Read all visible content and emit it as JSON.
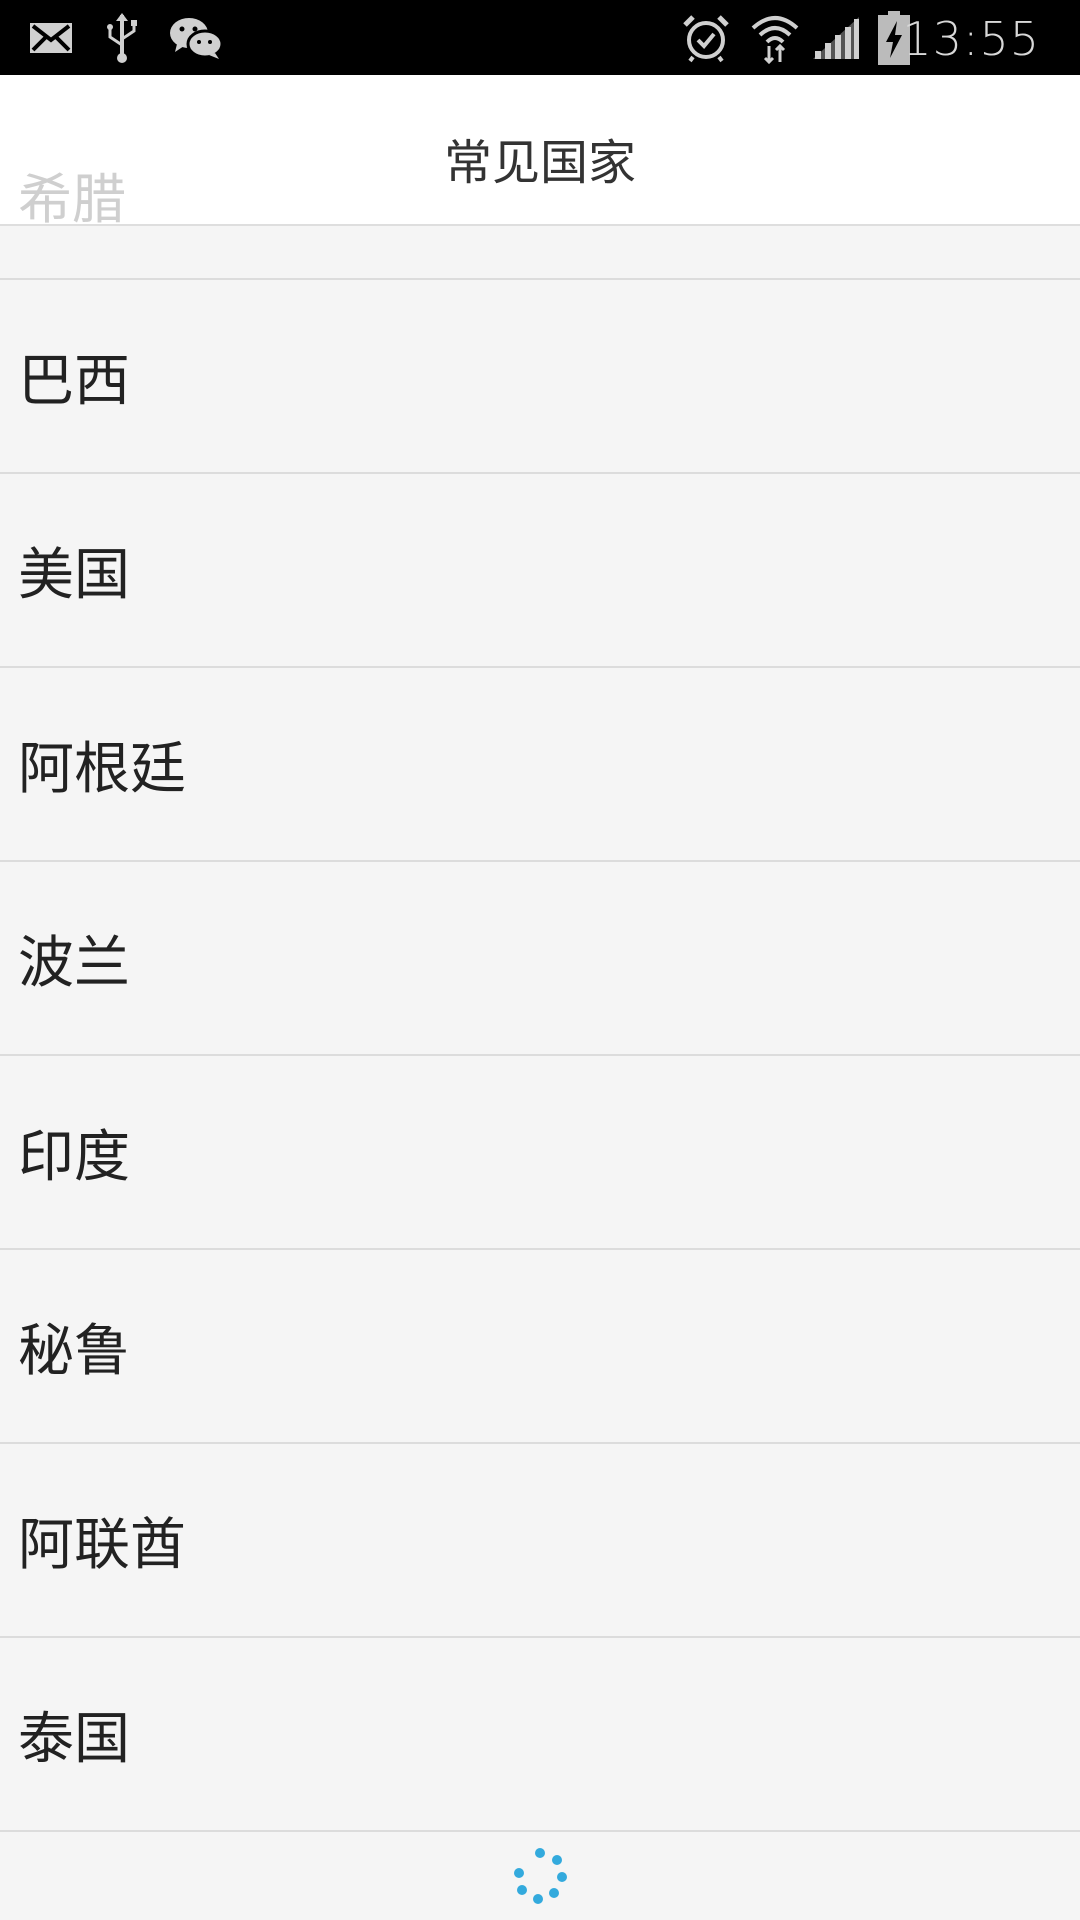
{
  "status_bar": {
    "time": "13:55",
    "icons": [
      "mail-icon",
      "usb-icon",
      "wechat-icon",
      "alarm-icon",
      "wifi-icon",
      "signal-icon",
      "battery-charging-icon"
    ]
  },
  "header": {
    "title": "常见国家",
    "ghost_label": "希腊"
  },
  "countries": [
    {
      "label": "巴西"
    },
    {
      "label": "美国"
    },
    {
      "label": "阿根廷"
    },
    {
      "label": "波兰"
    },
    {
      "label": "印度"
    },
    {
      "label": "秘鲁"
    },
    {
      "label": "阿联酋"
    },
    {
      "label": "泰国"
    }
  ],
  "colors": {
    "spinner": "#33aadd",
    "divider": "#dcdcdc",
    "background": "#f5f5f5"
  },
  "footer": {
    "loading_icon": "loading-spinner-icon"
  }
}
